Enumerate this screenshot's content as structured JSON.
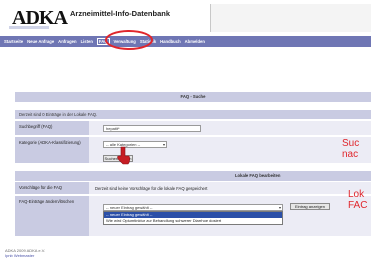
{
  "header": {
    "logo": "ADKA",
    "title": "Arzneimittel-Info-Datenbank"
  },
  "nav": {
    "items": [
      "Startseite",
      "Neue Anfrage",
      "Anfragen",
      "Listen",
      "FAQ",
      "Verwaltung",
      "Statistik",
      "Handbuch",
      "Abmelden"
    ]
  },
  "faq_search": {
    "title": "FAQ - Suche",
    "summary": "Derzeit sind 0 Einträge in der Lokale FAQ.",
    "search_label": "Suchbegriff (FAQ)",
    "search_value": "hepatit*",
    "category_label": "Kategorie (ADKA-Klassifizierung)",
    "category_value": "-- alle Kategorien --",
    "search_button": "Suchen starten"
  },
  "local_faq": {
    "title": "Lokale FAQ bearbeiten",
    "suggestions_label": "Vorschläge für die FAQ",
    "suggestions_text": "Derzeit sind keine Vorschläge für die lokale FAQ gespeichert",
    "entries_label": "FAQ-Einträge ändern/löschen",
    "entry_select": "-- neuer Eintrag gewählt --",
    "entry_options": [
      "-- neuer Eintrag gewählt --",
      "Wie wird Opiumtinktur zur Behandlung schwerer Diarrhoe dosiert"
    ],
    "entry_button": "Eintrag anzeigen"
  },
  "annotations": {
    "search_note": [
      "Suc",
      "nac"
    ],
    "local_note": [
      "Lok",
      "FAC"
    ]
  },
  "footer": {
    "copyright": "ADKA 2009 ADKA e.V.",
    "links": "Ipnb Webmaster"
  },
  "colors": {
    "nav": "#6f76b4",
    "highlight": "#e0262c",
    "panel": "#c9cbe2"
  }
}
